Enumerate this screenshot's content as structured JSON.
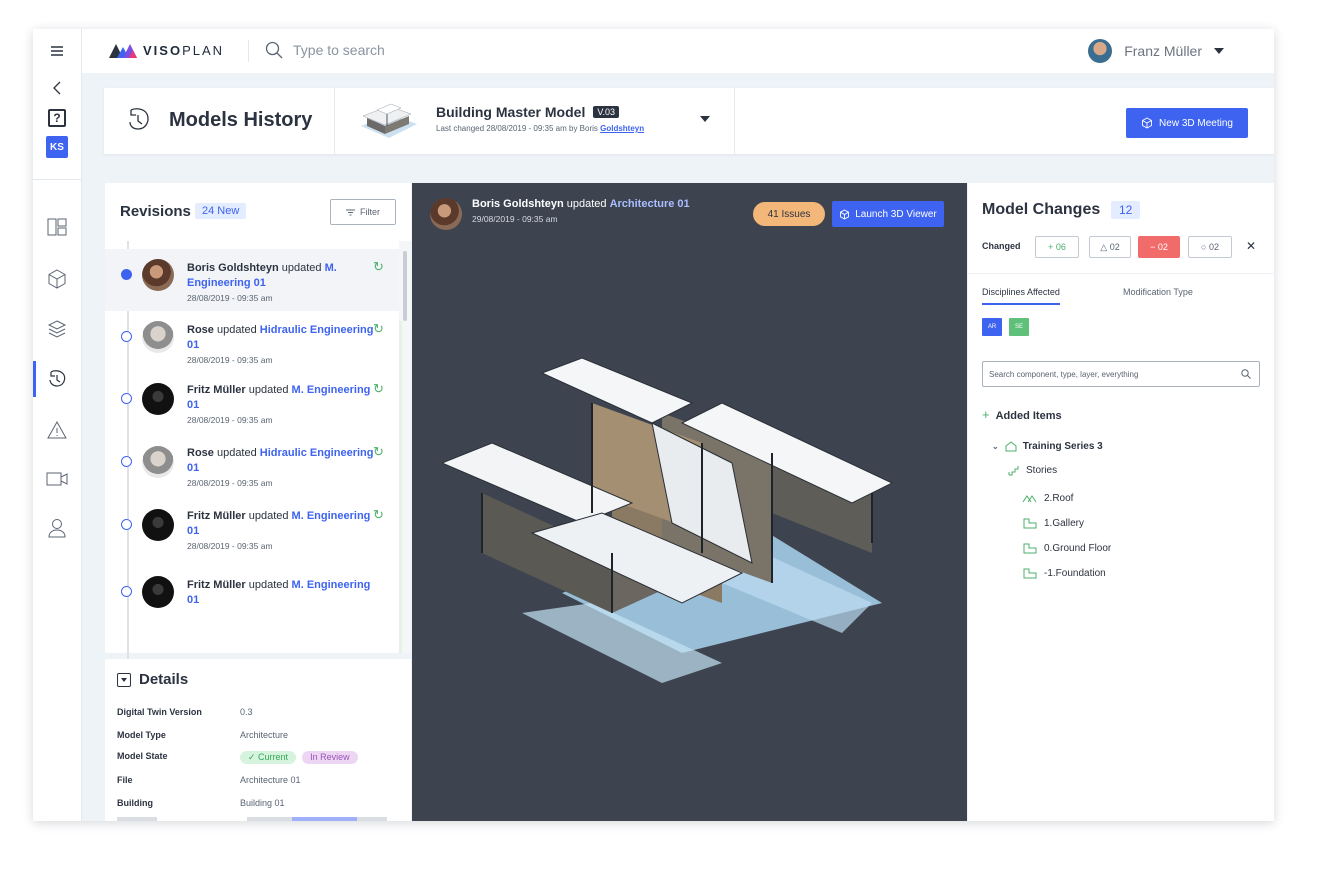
{
  "brand": {
    "logo_bold": "VISO",
    "logo_light": "PLAN"
  },
  "search": {
    "placeholder": "Type to search"
  },
  "user": {
    "name": "Franz Müller"
  },
  "rail": {
    "help": "?",
    "initials": "KS"
  },
  "header": {
    "title": "Models History",
    "model_name": "Building Master Model",
    "version": "V.03",
    "last_changed": "Last changed 28/08/2019 - 09:35 am by Boris ",
    "last_changed_user": "Goldshteyn",
    "new_meeting": "New 3D Meeting"
  },
  "revisions": {
    "title": "Revisions",
    "new_badge": "24 New",
    "filter": "Filter",
    "items": [
      {
        "name": "Boris Goldshteyn",
        "action": " updated ",
        "link": "M. Engineering 01",
        "date": "28/08/2019 - 09:35 am"
      },
      {
        "name": "Rose",
        "action": " updated ",
        "link": "Hidraulic Engineering 01",
        "date": "28/08/2019 - 09:35 am"
      },
      {
        "name": "Fritz Müller",
        "action": " updated ",
        "link": "M. Engineering 01",
        "date": "28/08/2019 - 09:35 am"
      },
      {
        "name": "Rose",
        "action": " updated ",
        "link": "Hidraulic Engineering 01",
        "date": "28/08/2019 - 09:35 am"
      },
      {
        "name": "Fritz Müller",
        "action": " updated ",
        "link": "M. Engineering 01",
        "date": "28/08/2019 - 09:35 am"
      },
      {
        "name": "Fritz Müller",
        "action": " updated ",
        "link": "M. Engineering 01",
        "date": ""
      }
    ]
  },
  "details": {
    "title": "Details",
    "rows": [
      {
        "key": "Digital Twin Version",
        "value": "0.3"
      },
      {
        "key": "Model Type",
        "value": "Architecture"
      },
      {
        "key": "Model State",
        "pill1": "✓ Current",
        "pill2": "In Review"
      },
      {
        "key": "File",
        "value": "Architecture 01"
      },
      {
        "key": "Building",
        "value": "Building 01"
      }
    ]
  },
  "viewer": {
    "name": "Boris Goldshteyn",
    "action": " updated ",
    "link": "Architecture 01",
    "date": "29/08/2019 - 09:35 am",
    "issues": "41 Issues",
    "launch": "Launch 3D Viewer"
  },
  "model_changes": {
    "title": "Model Changes",
    "count": "12",
    "changed_label": "Changed",
    "chip_added": "+ 06",
    "chip_modified": "△ 02",
    "chip_removed": "− 02",
    "chip_other": "○ 02",
    "close": "✕",
    "tab_disciplines": "Disciplines Affected",
    "tab_modification": "Modification Type",
    "disciplines": [
      "AR",
      "SE"
    ],
    "search_placeholder": "Search component, type, layer, everything",
    "added_items": "Added Items",
    "tree": {
      "series": "Training Series 3",
      "stories": "Stories",
      "levels": [
        "2.Roof",
        "1.Gallery",
        "0.Ground Floor",
        "-1.Foundation"
      ]
    }
  },
  "colors": {
    "accent": "#3d63f0",
    "success": "#4caf6a",
    "danger": "#f26b6b",
    "warning": "#f3b77a",
    "viewer_bg": "#3d4450"
  }
}
